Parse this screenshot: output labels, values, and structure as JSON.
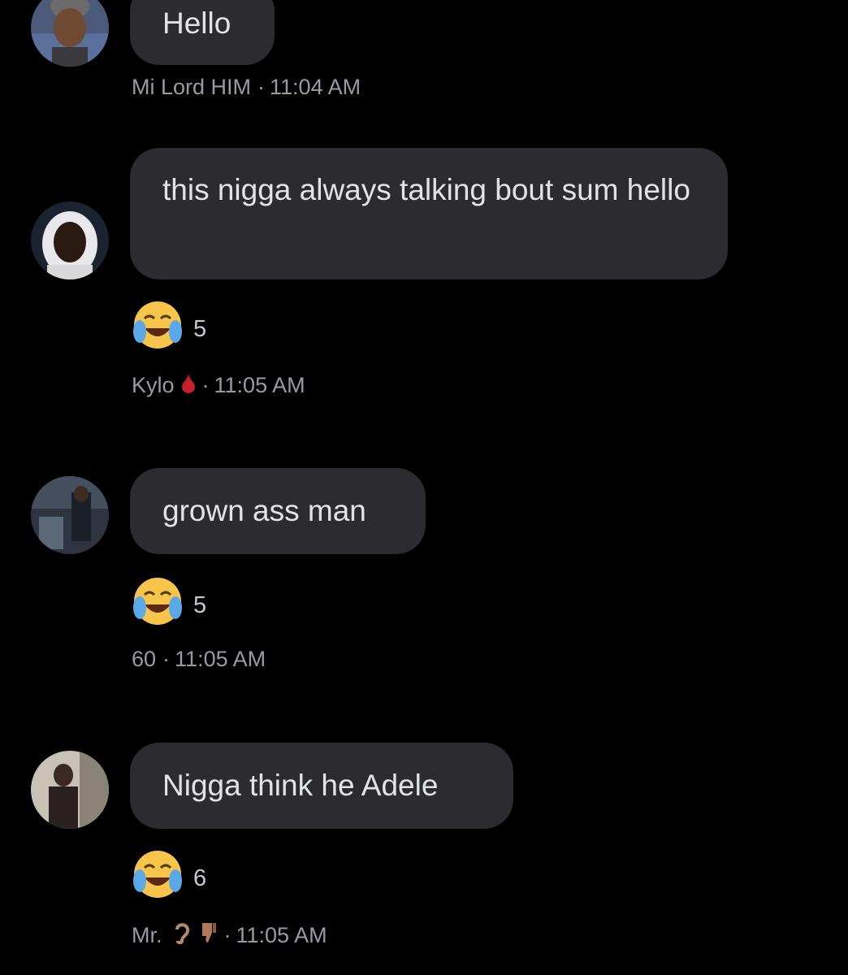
{
  "messages": [
    {
      "text": "Hello",
      "sender": "Mi Lord HIM",
      "time": "11:04 AM",
      "reaction": null,
      "avatar": "avatar-man-gray-beanie"
    },
    {
      "text": "this nigga always talking bout sum hello",
      "sender": "Kylo",
      "sender_icon": "blood-drop-icon",
      "time": "11:05 AM",
      "reaction": {
        "emoji": "face-with-tears-of-joy",
        "count": "5"
      },
      "avatar": "avatar-man-white-hood"
    },
    {
      "text": "grown ass man",
      "sender": "60",
      "time": "11:05 AM",
      "reaction": {
        "emoji": "face-with-tears-of-joy",
        "count": "5"
      },
      "avatar": "avatar-street-photo"
    },
    {
      "text": "Nigga think he Adele",
      "sender": "Mr.",
      "sender_icons": [
        "ear-icon",
        "thumbs-down-icon"
      ],
      "time": "11:05 AM",
      "reaction": {
        "emoji": "face-with-tears-of-joy",
        "count": "6"
      },
      "avatar": "avatar-mirror-selfie"
    }
  ],
  "separator": "·",
  "colors": {
    "background": "#000000",
    "bubble": "#2b2b30",
    "bubble_text": "#e2e3e8",
    "meta_text": "#9a9aa2",
    "emoji_yellow": "#f6c54a",
    "tear_blue": "#5aa8e8",
    "blood_red": "#c8202a"
  }
}
